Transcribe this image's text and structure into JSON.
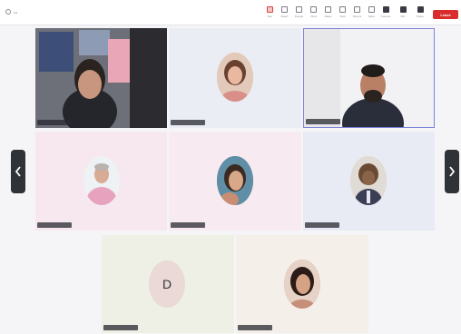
{
  "toolbar": {
    "meeting_label": "•••",
    "tools": [
      {
        "icon": "record-icon",
        "label": "Rec"
      },
      {
        "icon": "reactions-icon",
        "label": "React"
      },
      {
        "icon": "people-icon",
        "label": "People"
      },
      {
        "icon": "chat-icon",
        "label": "Chat"
      },
      {
        "icon": "raise-hand-icon",
        "label": "Raise"
      },
      {
        "icon": "view-icon",
        "label": "View"
      },
      {
        "icon": "rooms-icon",
        "label": "Rooms"
      },
      {
        "icon": "more-icon",
        "label": "More"
      }
    ],
    "right_tools": [
      {
        "icon": "camera-icon",
        "label": "Camera"
      },
      {
        "icon": "mic-icon",
        "label": "Mic"
      },
      {
        "icon": "share-icon",
        "label": "Share"
      }
    ],
    "leave_label": "Leave",
    "leave_color": "#d92d2d"
  },
  "tiles": [
    {
      "name": "",
      "type": "video"
    },
    {
      "name": "",
      "type": "avatar"
    },
    {
      "name": "",
      "type": "video"
    },
    {
      "name": "",
      "type": "avatar"
    },
    {
      "name": "",
      "type": "avatar"
    },
    {
      "name": "",
      "type": "avatar"
    },
    {
      "name": "",
      "type": "letter",
      "letter": "D"
    },
    {
      "name": "",
      "type": "avatar"
    }
  ],
  "active_speaker_color": "#7b83d9",
  "nav": {
    "prev": "‹",
    "next": "›"
  }
}
